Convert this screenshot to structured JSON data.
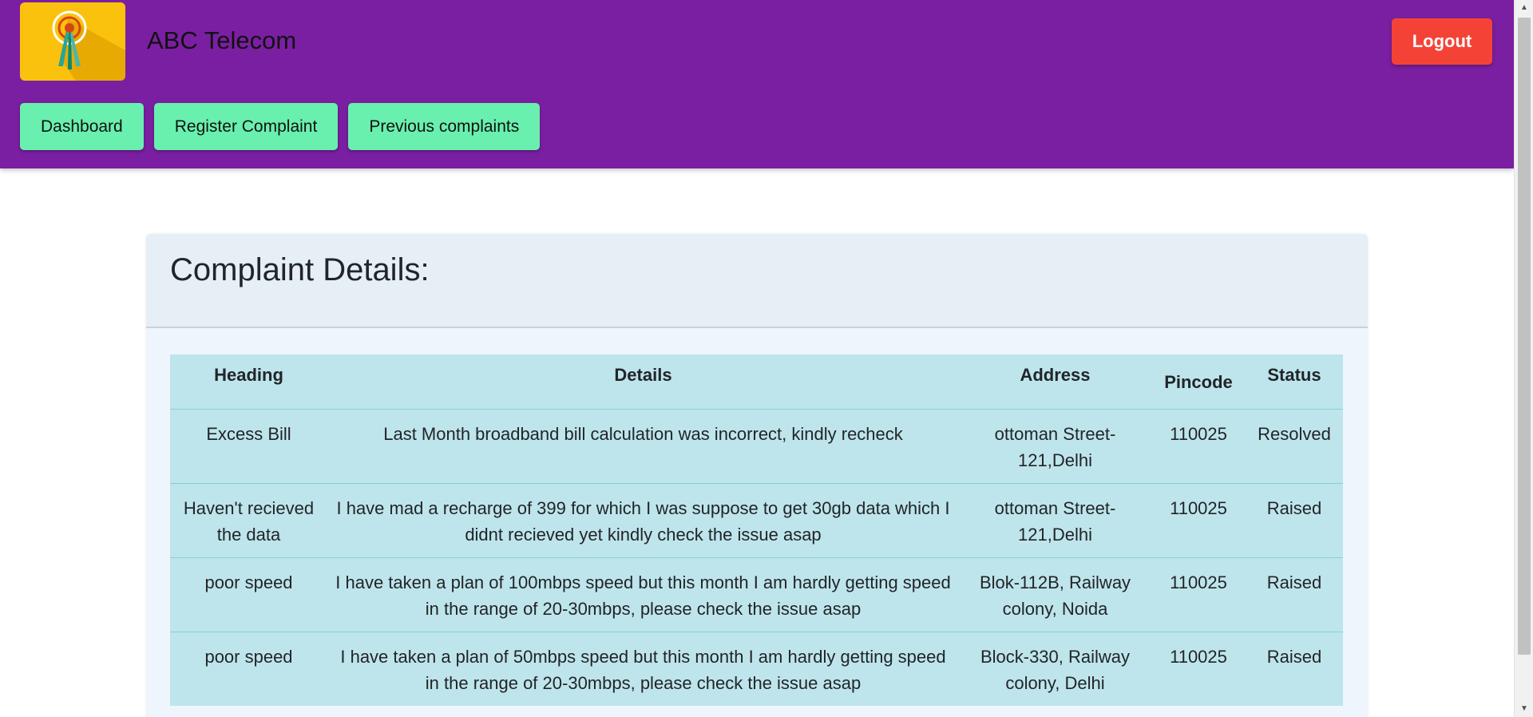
{
  "app": {
    "brand": "ABC Telecom",
    "logout_label": "Logout",
    "accent_color": "#7b1fa2",
    "nav_color": "#69f0ae",
    "logout_color": "#f44336"
  },
  "nav": {
    "items": [
      {
        "label": "Dashboard"
      },
      {
        "label": "Register Complaint"
      },
      {
        "label": "Previous complaints"
      }
    ]
  },
  "card": {
    "title": "Complaint Details:"
  },
  "table": {
    "headers": {
      "heading": "Heading",
      "details": "Details",
      "address": "Address",
      "pincode": "Pincode",
      "status": "Status"
    },
    "rows": [
      {
        "heading": "Excess Bill",
        "details": "Last Month broadband bill calculation was incorrect, kindly recheck",
        "address": "ottoman Street-121,Delhi",
        "pincode": "110025",
        "status": "Resolved"
      },
      {
        "heading": "Haven't recieved the data",
        "details": "I have mad a recharge of 399 for which I was suppose to get 30gb data which I didnt recieved yet kindly check the issue asap",
        "address": "ottoman Street-121,Delhi",
        "pincode": "110025",
        "status": "Raised"
      },
      {
        "heading": "poor speed",
        "details": "I have taken a plan of 100mbps speed but this month I am hardly getting speed in the range of 20-30mbps, please check the issue asap",
        "address": "Blok-112B, Railway colony, Noida",
        "pincode": "110025",
        "status": "Raised"
      },
      {
        "heading": "poor speed",
        "details": "I have taken a plan of 50mbps speed but this month I am hardly getting speed in the range of 20-30mbps, please check the issue asap",
        "address": "Block-330, Railway colony, Delhi",
        "pincode": "110025",
        "status": "Raised"
      }
    ]
  },
  "icons": {
    "logo": "signal-tower-icon",
    "scroll_up": "scroll-up-arrow-icon",
    "scroll_down": "scroll-down-arrow-icon"
  }
}
